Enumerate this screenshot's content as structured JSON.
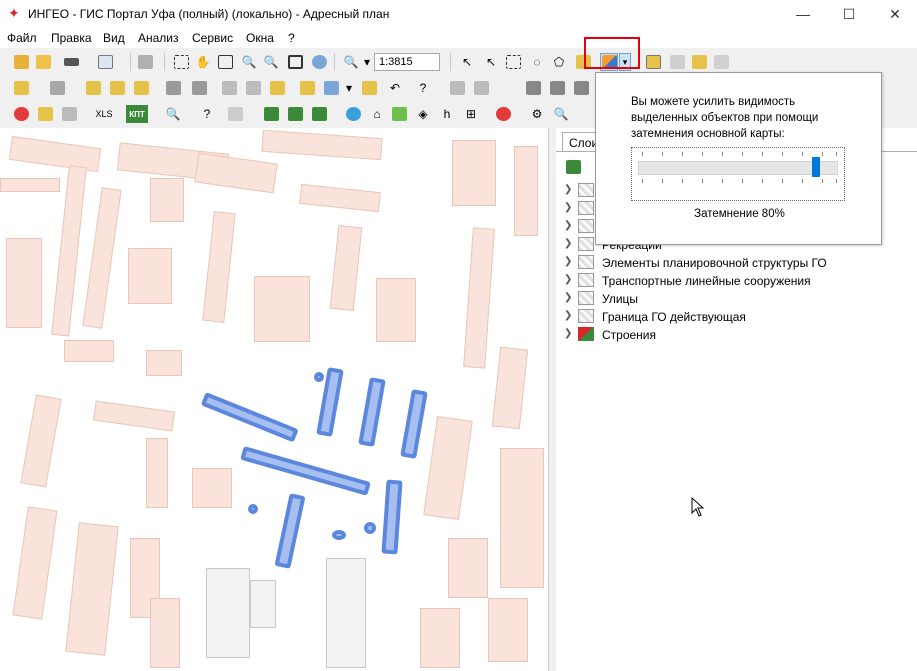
{
  "window": {
    "title": "ИНГЕО - ГИС Портал Уфа (полный) (локально) - Адресный план"
  },
  "menu": [
    "Файл",
    "Правка",
    "Вид",
    "Анализ",
    "Сервис",
    "Окна",
    "?"
  ],
  "toolbar": {
    "scale_value": "1:3815",
    "xls_label": "XLS",
    "kpt_label": "КПТ"
  },
  "panel": {
    "tab_label": "Слои",
    "layers": [
      "Рекреации",
      "Элементы планировочной структуры ГО",
      "Транспортные линейные сооружения",
      "Улицы",
      "Граница ГО действующая",
      "Строения"
    ]
  },
  "popup": {
    "text": "Вы можете усилить видимость выделенных объектов при помощи затемнения основной карты:",
    "label": "Затемнение 80%",
    "darkening_percent": 80
  },
  "colors": {
    "building_fill": "#f9e3da",
    "selection_fill": "#a6bff0",
    "selection_border": "#5b87de",
    "highlight_box": "#e3000f",
    "slider_thumb": "#0078d7"
  }
}
